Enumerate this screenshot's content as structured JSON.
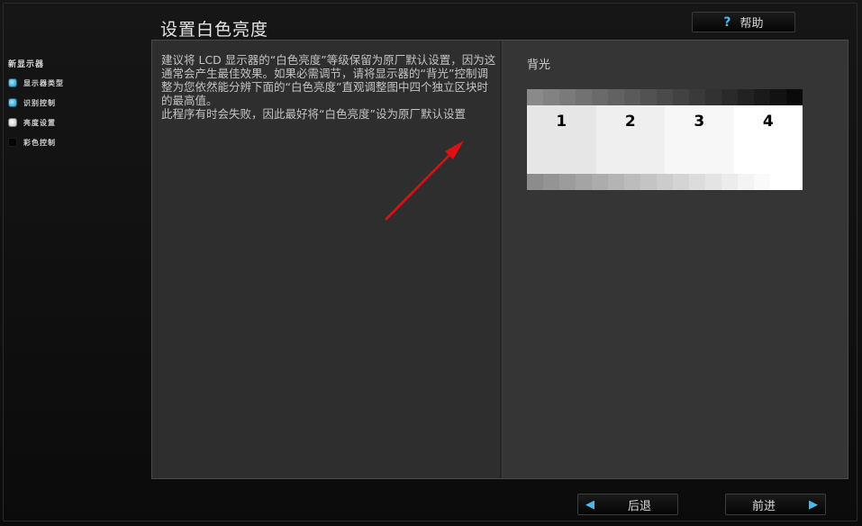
{
  "header": {
    "title": "设置白色亮度",
    "help_label": "帮助",
    "help_icon": "?"
  },
  "sidebar": {
    "title": "新显示器",
    "items": [
      {
        "label": "显示器类型",
        "state": "done",
        "dot_color": "#3aa7d6"
      },
      {
        "label": "识别控制",
        "state": "done",
        "dot_color": "#3aa7d6"
      },
      {
        "label": "亮度设置",
        "state": "current",
        "dot_color": "#ffffff"
      },
      {
        "label": "彩色控制",
        "state": "pending",
        "dot_color": "#000000"
      }
    ]
  },
  "main": {
    "description": [
      "建议将 LCD 显示器的“白色亮度”等级保留为原厂默认设置，因为这通常会产生最佳效果。如果必需调节，请将显示器的“背光”控制调整为您依然能分辨下面的“白色亮度”直观调整图中四个独立区块时的最高值。",
      "此程序有时会失败，因此最好将“白色亮度”设为原厂默认设置"
    ],
    "backlight_label": "背光",
    "blocks": [
      "1",
      "2",
      "3",
      "4"
    ]
  },
  "footer": {
    "back_label": "后退",
    "next_label": "前进"
  },
  "colors": {
    "accent": "#4fb9e6",
    "arrow": "#e01010",
    "block_colors": [
      "#e6e6e6",
      "#efefef",
      "#f7f7f7",
      "#ffffff"
    ],
    "top_strip": [
      "#8a8a8a",
      "#828282",
      "#7a7a7a",
      "#727272",
      "#6a6a6a",
      "#626262",
      "#5a5a5a",
      "#525252",
      "#4a4a4a",
      "#424242",
      "#3a3a3a",
      "#323232",
      "#2a2a2a",
      "#222222",
      "#1a1a1a",
      "#121212",
      "#0a0a0a"
    ],
    "bottom_strip": [
      "#8c8c8c",
      "#949494",
      "#9c9c9c",
      "#a4a4a4",
      "#acacac",
      "#b4b4b4",
      "#bcbcbc",
      "#c4c4c4",
      "#cccccc",
      "#d4d4d4",
      "#dcdcdc",
      "#e4e4e4",
      "#ececec",
      "#f4f4f4",
      "#fafafa",
      "#ffffff",
      "#ffffff"
    ]
  }
}
